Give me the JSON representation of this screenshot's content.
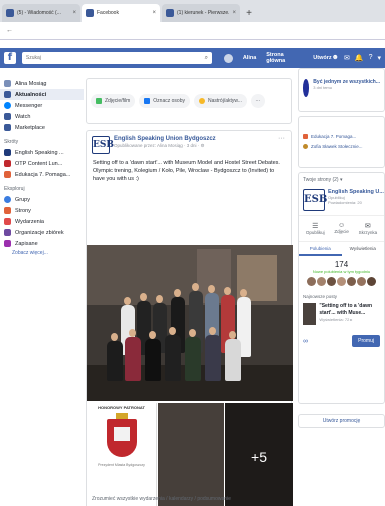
{
  "browser": {
    "tabs": [
      {
        "title": "(5) - Wiadomość (...",
        "active": false
      },
      {
        "title": "Facebook",
        "active": true
      },
      {
        "title": "(1) kierunek - Pierwsze...",
        "active": false
      }
    ],
    "new_tab": "+",
    "close": "×"
  },
  "fb": {
    "logo": "f",
    "search_placeholder": "Szukaj",
    "nav_name": "Alina",
    "nav_home": "Strona główna",
    "nav_find": "Utwórz",
    "nav_icons": [
      "☻",
      "✉",
      "🔔",
      "?",
      "▾"
    ]
  },
  "sidebar": {
    "items": [
      {
        "label": "Alina Mosiąg",
        "color": "#7a8fb8",
        "active": false
      },
      {
        "label": "Aktualności",
        "color": "#3b5998",
        "active": true
      },
      {
        "label": "Messenger",
        "color": "#0084ff",
        "active": false
      },
      {
        "label": "Watch",
        "color": "#3b5998",
        "active": false
      },
      {
        "label": "Marketplace",
        "color": "#3b5998",
        "active": false
      }
    ],
    "section_pages": "Skróty",
    "pages": [
      {
        "label": "English Speaking ...",
        "color": "#1f3a7a"
      },
      {
        "label": "OTP Content Lun...",
        "color": "#c0282d"
      },
      {
        "label": "Edukacja 7. Pomaga...",
        "color": "#e0623a"
      }
    ],
    "section_explore": "Eksploruj",
    "explore": [
      {
        "label": "Grupy",
        "color": "#3b7de0"
      },
      {
        "label": "Strony",
        "color": "#e0623a"
      },
      {
        "label": "Wydarzenia",
        "color": "#e04a4a"
      },
      {
        "label": "Organizacje zbiórek",
        "color": "#6e4aa0"
      },
      {
        "label": "Zapisane",
        "color": "#9b2fae"
      }
    ],
    "more": "Zobacz więcej..."
  },
  "composer": {
    "chips": [
      {
        "label": "Zdjęcie/film",
        "color": "#45bd62"
      },
      {
        "label": "Oznacz osoby",
        "color": "#1877f2"
      },
      {
        "label": "Nastrój/aktyw...",
        "color": "#f7b928"
      }
    ],
    "more": "···"
  },
  "post": {
    "logo": "ESB",
    "author": "English Speaking Union Bydgoszcz",
    "meta": "Opublikowane przez: Alina Mosiąg · 3 dni · ⚙",
    "text": "Setting off to a 'dawn start'... with Museum Model and Hostel Street Debates. Olympic trening, Kolegium / Koło, Pile, Wroclaw - Bydgoszcz to (Invited) to have you with us :)",
    "thumb1_caption": "HONOROWY PATRONAT",
    "thumb1_sub": "Prezydent Miasta Bydgoszczy",
    "plus_more": "+5"
  },
  "next_post": "Zrozumieć wszystkie wydarzenia / kalendarzy / podsumowanie",
  "right": {
    "group_title": "Być jednym ze wszystkich...",
    "group_sub": "3 dni temu",
    "list": [
      {
        "label": "Edukacja 7. Pomaga...",
        "color": "#e0623a"
      },
      {
        "label": "Zofia Sławek Stołecznie...",
        "color": "#c08a2a"
      }
    ],
    "page_section": "Twoje strony (2) ▾",
    "page_logo": "ESB",
    "page_name": "English Speaking U...",
    "page_meta1": "Opublikuj",
    "page_meta2": "Powiadomienia: 20",
    "actions": [
      {
        "icon": "☰",
        "label": "Opublikuj"
      },
      {
        "icon": "☺",
        "label": "Zdjęcie"
      },
      {
        "icon": "✉",
        "label": "Skrzynka"
      }
    ],
    "tabs": [
      "Polubienia",
      "Wyświetlenia"
    ],
    "count": "174",
    "count_sub": "Nowe polubienia w tym tygodniu",
    "recent_head": "Najnowsze posty",
    "recent_text": "\"Setting off to a 'dawn start'... with Muse...",
    "recent_meta": "Wyświetlenia: 72 ▸",
    "promote": "Promuj",
    "bottom_link": "Utwórz promocję"
  }
}
